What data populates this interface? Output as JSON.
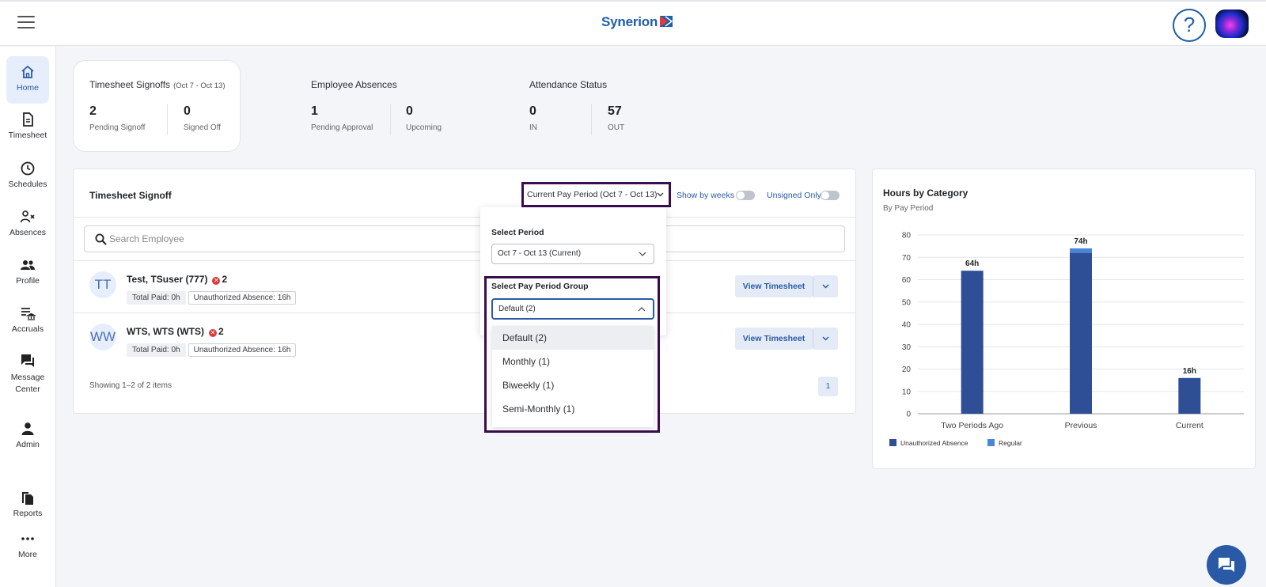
{
  "app": {
    "logo_text": "Synerion",
    "help_label": "?"
  },
  "sidebar": {
    "items": [
      {
        "label": "Home",
        "icon": "home-icon"
      },
      {
        "label": "Timesheet",
        "icon": "document-icon"
      },
      {
        "label": "Schedules",
        "icon": "clock-icon"
      },
      {
        "label": "Absences",
        "icon": "person-x-icon"
      },
      {
        "label": "Profile",
        "icon": "people-icon"
      },
      {
        "label": "Accruals",
        "icon": "list-bank-icon"
      },
      {
        "label": "Message",
        "label2": "Center",
        "icon": "chat-icon"
      },
      {
        "label": "Admin",
        "icon": "person-icon"
      },
      {
        "label": "Reports",
        "icon": "reports-icon"
      },
      {
        "label": "More",
        "icon": "more-dots-icon"
      }
    ]
  },
  "summary": {
    "signoffs": {
      "title": "Timesheet Signoffs",
      "range": "(Oct 7 - Oct 13)",
      "a_num": "2",
      "a_label": "Pending Signoff",
      "b_num": "0",
      "b_label": "Signed Off"
    },
    "absences": {
      "title": "Employee Absences",
      "a_num": "1",
      "a_label": "Pending Approval",
      "b_num": "0",
      "b_label": "Upcoming"
    },
    "attendance": {
      "title": "Attendance Status",
      "a_num": "0",
      "a_label": "IN",
      "b_num": "57",
      "b_label": "OUT"
    }
  },
  "panel": {
    "title": "Timesheet Signoff",
    "period_button": "Current Pay Period (Oct 7 - Oct 13)",
    "show_by_weeks": "Show by weeks",
    "unsigned_only": "Unsigned Only",
    "search_placeholder": "Search Employee",
    "employees": [
      {
        "initials": "TT",
        "name": "Test, TSuser (777)",
        "errors": "2",
        "total_paid": "Total Paid: 0h",
        "absence": "Unauthorized Absence: 16h"
      },
      {
        "initials": "WW",
        "name": "WTS, WTS (WTS)",
        "errors": "2",
        "total_paid": "Total Paid: 0h",
        "absence": "Unauthorized Absence: 16h"
      }
    ],
    "view_timesheet": "View Timesheet",
    "showing": "Showing 1–2 of 2 items",
    "page": "1"
  },
  "popover": {
    "period_label": "Select Period",
    "period_value": "Oct 7 - Oct 13 (Current)",
    "group_label": "Select Pay Period Group",
    "group_value": "Default (2)",
    "options": [
      "Default (2)",
      "Monthly (1)",
      "Biweekly (1)",
      "Semi-Monthly (1)"
    ]
  },
  "chart_data": {
    "type": "bar",
    "title": "Hours by Category",
    "subtitle": "By Pay Period",
    "categories": [
      "Two Periods Ago",
      "Previous",
      "Current"
    ],
    "series": [
      {
        "name": "Unauthorized Absence",
        "values": [
          64,
          72,
          16
        ],
        "color": "#2e4f96"
      },
      {
        "name": "Regular",
        "values": [
          0,
          2,
          0
        ],
        "color": "#4a86d8"
      }
    ],
    "totals": [
      "64h",
      "74h",
      "16h"
    ],
    "ylim": [
      0,
      80
    ],
    "yticks": [
      "0",
      "10",
      "20",
      "30",
      "40",
      "50",
      "60",
      "70",
      "80"
    ],
    "stacked": true,
    "legend": "bottom-left"
  }
}
